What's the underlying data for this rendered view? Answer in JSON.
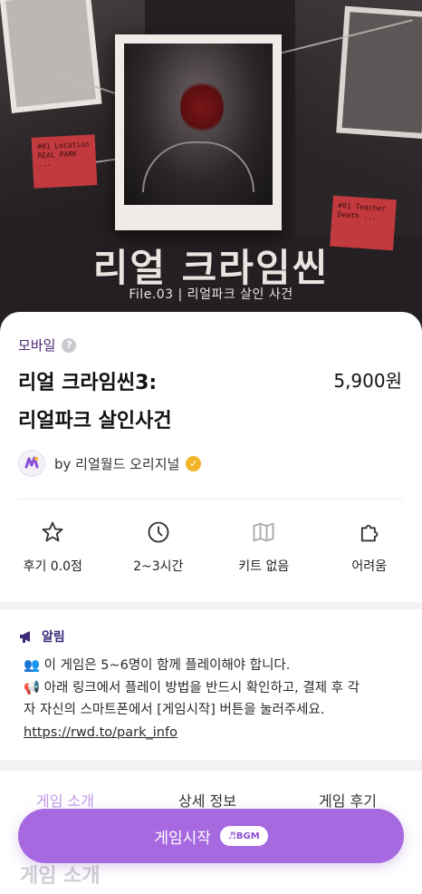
{
  "hero": {
    "title_art": "리얼 크라임씬",
    "subtitle_art": "File.03 | 리얼파크 살인 사건",
    "note_left": "#01 Location REAL PARK ...",
    "note_right": "#01 Teacher Death ..."
  },
  "product": {
    "platform": "모바일",
    "title_line1": "리얼 크라임씬3:",
    "title_line2": "리얼파크 살인사건",
    "price": "5,900원",
    "maker": "by 리얼월드 오리지널"
  },
  "stats": [
    {
      "icon": "star-icon",
      "label": "후기 0.0점"
    },
    {
      "icon": "clock-icon",
      "label": "2~3시간"
    },
    {
      "icon": "map-icon",
      "label": "키트 없음"
    },
    {
      "icon": "puzzle-icon",
      "label": "어려움"
    }
  ],
  "notice": {
    "heading": "알림",
    "line1": "👥 이 게임은 5~6명이 함께 플레이해야 합니다.",
    "line2": "📢 아래 링크에서 플레이 방법을 반드시 확인하고, 결제 후 각",
    "line3": "자 자신의 스마트폰에서 [게임시작] 버튼을 눌러주세요.",
    "link": "https://rwd.to/park_info"
  },
  "tabs": [
    {
      "label": "게임 소개",
      "active": true
    },
    {
      "label": "상세 정보",
      "active": false
    },
    {
      "label": "게임 후기",
      "active": false
    }
  ],
  "section_title": "게임 소개",
  "cta": {
    "label": "게임시작",
    "badge": "♬BGM"
  },
  "colors": {
    "accent": "#a769e0",
    "tab_active": "#c199e8",
    "brand_dark": "#3a2a78",
    "verified": "#f2b52a"
  }
}
